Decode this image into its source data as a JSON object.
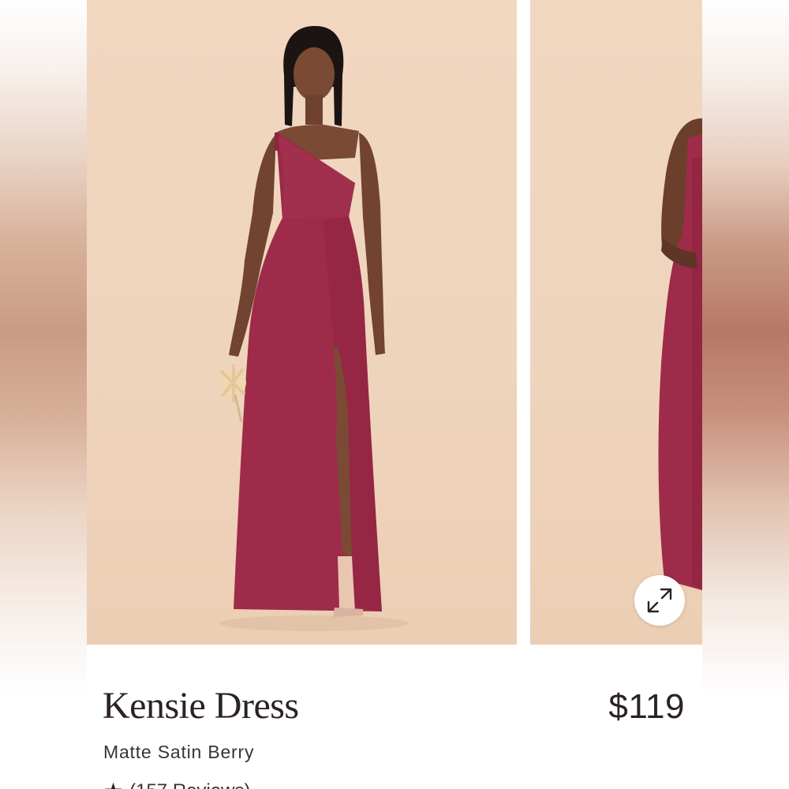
{
  "product": {
    "name": "Kensie Dress",
    "variant": "Matte Satin Berry",
    "price": "$119",
    "reviews_text": "(157 Reviews)"
  },
  "carousel": {
    "slides": [
      {
        "description": "model wearing dress, front view"
      },
      {
        "description": "model wearing dress, side view"
      }
    ]
  },
  "icons": {
    "expand": "expand-arrows-icon",
    "star": "star-icon"
  },
  "colors": {
    "dress": "#9e2b4a",
    "backdrop": "#efd4bd",
    "text": "#2b2323"
  }
}
